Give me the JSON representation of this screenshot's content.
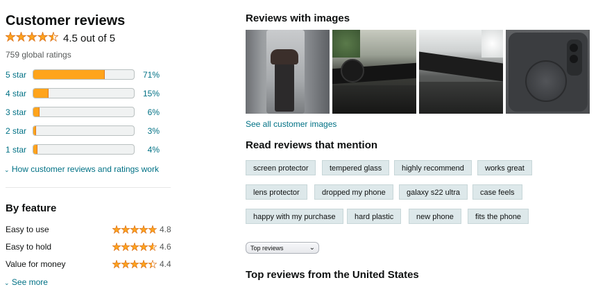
{
  "summary": {
    "title": "Customer reviews",
    "rating_text": "4.5 out of 5",
    "rating": 4.5,
    "global_ratings": "759 global ratings",
    "histogram": [
      {
        "label": "5 star",
        "percent_text": "71%",
        "fraction": 0.71
      },
      {
        "label": "4 star",
        "percent_text": "15%",
        "fraction": 0.15
      },
      {
        "label": "3 star",
        "percent_text": "6%",
        "fraction": 0.06
      },
      {
        "label": "2 star",
        "percent_text": "3%",
        "fraction": 0.03
      },
      {
        "label": "1 star",
        "percent_text": "4%",
        "fraction": 0.04
      }
    ],
    "how_link": "How customer reviews and ratings work"
  },
  "by_feature": {
    "title": "By feature",
    "items": [
      {
        "label": "Easy to use",
        "score": "4.8",
        "rating": 4.8
      },
      {
        "label": "Easy to hold",
        "score": "4.6",
        "rating": 4.6
      },
      {
        "label": "Value for money",
        "score": "4.4",
        "rating": 4.4
      }
    ],
    "see_more": "See more"
  },
  "images_section": {
    "title": "Reviews with images",
    "see_all": "See all customer images"
  },
  "mentions": {
    "title": "Read reviews that mention",
    "chips": [
      "screen protector",
      "tempered glass",
      "highly recommend",
      "works great",
      "lens protector",
      "dropped my phone",
      "galaxy s22 ultra",
      "case feels",
      "happy with my purchase",
      "hard plastic",
      "new phone",
      "fits the phone"
    ]
  },
  "sort": {
    "selected": "Top reviews"
  },
  "top_reviews": {
    "title": "Top reviews from the United States"
  },
  "colors": {
    "star": "#ffa41c",
    "star_stroke": "#de7921",
    "link": "#007185",
    "chip_bg": "#dde8ea"
  }
}
